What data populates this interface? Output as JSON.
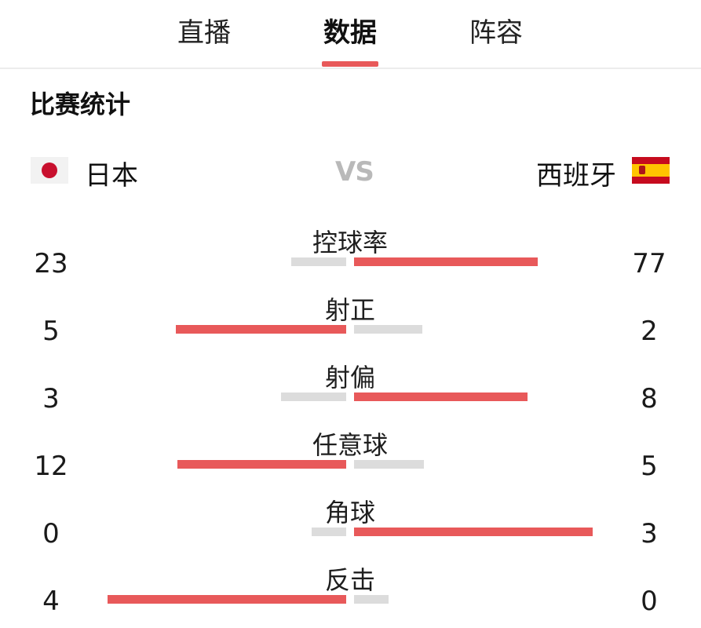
{
  "tabs": [
    {
      "label": "直播",
      "active": false
    },
    {
      "label": "数据",
      "active": true
    },
    {
      "label": "阵容",
      "active": false
    }
  ],
  "section_title": "比赛统计",
  "teams": {
    "home": {
      "name": "日本",
      "flag": "japan-flag-icon"
    },
    "vs": "VS",
    "away": {
      "name": "西班牙",
      "flag": "spain-flag-icon"
    }
  },
  "colors": {
    "accent": "#e8595a",
    "bar_track": "#dcdcdc",
    "vs": "#b9b9b9"
  },
  "stats": [
    {
      "label": "控球率",
      "home": "23",
      "away": "77"
    },
    {
      "label": "射正",
      "home": "5",
      "away": "2"
    },
    {
      "label": "射偏",
      "home": "3",
      "away": "8"
    },
    {
      "label": "任意球",
      "home": "12",
      "away": "5"
    },
    {
      "label": "角球",
      "home": "0",
      "away": "3"
    },
    {
      "label": "反击",
      "home": "4",
      "away": "0"
    }
  ]
}
